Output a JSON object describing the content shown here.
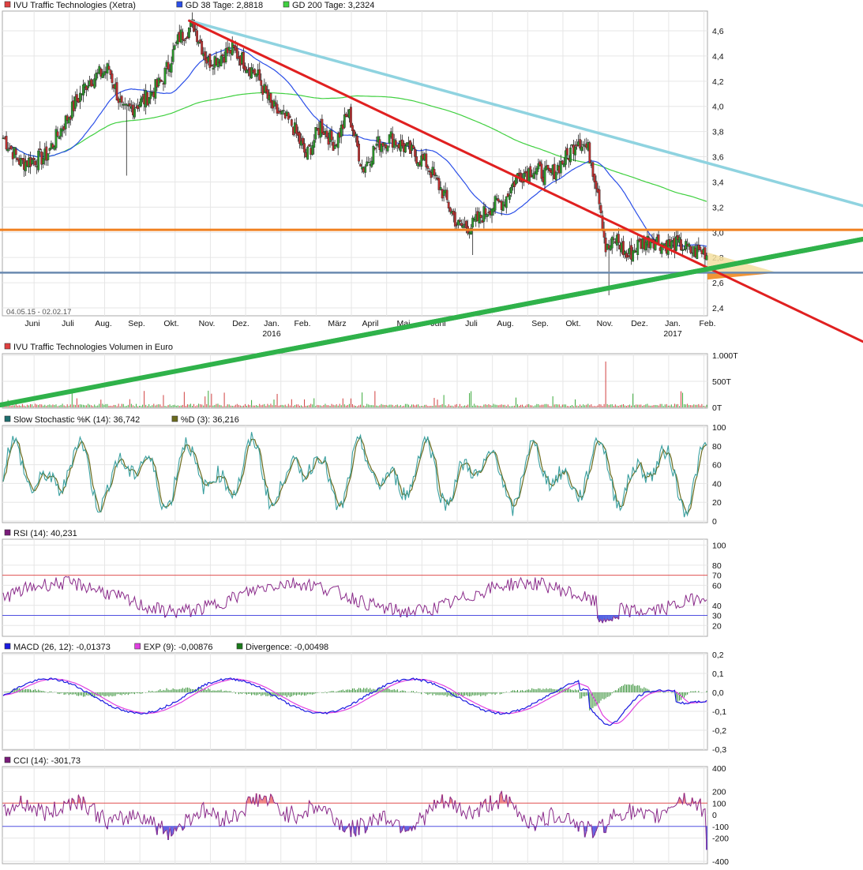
{
  "instrument": "IVU Traffic Technologies",
  "price_panel": {
    "legend": [
      {
        "label": "IVU Traffic Technologies (Xetra)",
        "color": "#e04040"
      },
      {
        "label": "GD 38 Tage: 2,8818",
        "color": "#2b4fe8"
      },
      {
        "label": "GD 200 Tage: 3,2324",
        "color": "#40d040"
      }
    ],
    "date_range": "04.05.15 - 02.02.17",
    "y_ticks": [
      "4,6",
      "4,4",
      "4,2",
      "4,0",
      "3,8",
      "3,6",
      "3,4",
      "3,2",
      "3,0",
      "2,8",
      "2,6",
      "2,4"
    ],
    "x_ticks": [
      "Juni",
      "Juli",
      "Aug.",
      "Sep.",
      "Okt.",
      "Nov.",
      "Dez.",
      "Jan.",
      "Feb.",
      "März",
      "April",
      "Mai",
      "Juni",
      "Juli",
      "Aug.",
      "Sep.",
      "Okt.",
      "Nov.",
      "Dez.",
      "Jan.",
      "Feb."
    ],
    "year_labels": [
      "2016",
      "2017"
    ]
  },
  "volume_panel": {
    "legend": [
      {
        "label": "IVU Traffic Technologies Volumen in Euro",
        "color": "#e04040"
      }
    ],
    "y_ticks": [
      "1.000T",
      "500T",
      "0T"
    ]
  },
  "stoch_panel": {
    "legend": [
      {
        "label": "Slow Stochastic %K (14): 36,742",
        "color": "#1d6e6e"
      },
      {
        "label": "%D (3): 36,216",
        "color": "#6b6b1d"
      }
    ],
    "y_ticks": [
      "100",
      "80",
      "60",
      "40",
      "20",
      "0"
    ]
  },
  "rsi_panel": {
    "legend": [
      {
        "label": "RSI (14): 40,231",
        "color": "#7a1a7a"
      }
    ],
    "y_ticks": [
      "100",
      "80",
      "60",
      "40",
      "20"
    ],
    "band_labels": [
      "70",
      "30"
    ]
  },
  "macd_panel": {
    "legend": [
      {
        "label": "MACD (26, 12): -0,01373",
        "color": "#1a1ae0"
      },
      {
        "label": "EXP (9): -0,00876",
        "color": "#e040e0"
      },
      {
        "label": "Divergence: -0,00498",
        "color": "#1a7a1a"
      }
    ],
    "y_ticks": [
      "0,2",
      "0,1",
      "0,0",
      "-0,1",
      "-0,2",
      "-0,3"
    ]
  },
  "cci_panel": {
    "legend": [
      {
        "label": "CCI (14): -301,73",
        "color": "#7a1a7a"
      }
    ],
    "y_ticks": [
      "400",
      "200",
      "0",
      "-200",
      "-400"
    ],
    "band_labels": [
      "100",
      "-100"
    ]
  },
  "chart_data": {
    "type": "line",
    "title": "IVU Traffic Technologies (Xetra)",
    "x_range": [
      "2015-05-04",
      "2017-02-02"
    ],
    "ylim": [
      2.4,
      4.7
    ],
    "price_anchors": [
      {
        "month": 0.0,
        "close": 3.75
      },
      {
        "month": 0.5,
        "close": 3.55
      },
      {
        "month": 1.2,
        "close": 3.6
      },
      {
        "month": 1.8,
        "close": 3.9
      },
      {
        "month": 2.4,
        "close": 4.2
      },
      {
        "month": 3.0,
        "close": 4.3
      },
      {
        "month": 3.4,
        "close": 3.95
      },
      {
        "month": 4.0,
        "close": 4.05
      },
      {
        "month": 4.5,
        "close": 4.2
      },
      {
        "month": 5.0,
        "close": 4.55
      },
      {
        "month": 5.4,
        "close": 4.65
      },
      {
        "month": 5.8,
        "close": 4.35
      },
      {
        "month": 6.5,
        "close": 4.45
      },
      {
        "month": 7.2,
        "close": 4.25
      },
      {
        "month": 7.6,
        "close": 4.0
      },
      {
        "month": 8.2,
        "close": 3.85
      },
      {
        "month": 8.6,
        "close": 3.6
      },
      {
        "month": 9.0,
        "close": 3.85
      },
      {
        "month": 9.4,
        "close": 3.7
      },
      {
        "month": 9.8,
        "close": 3.95
      },
      {
        "month": 10.2,
        "close": 3.5
      },
      {
        "month": 10.6,
        "close": 3.7
      },
      {
        "month": 11.0,
        "close": 3.75
      },
      {
        "month": 11.5,
        "close": 3.65
      },
      {
        "month": 12.0,
        "close": 3.55
      },
      {
        "month": 12.5,
        "close": 3.3
      },
      {
        "month": 12.9,
        "close": 3.05
      },
      {
        "month": 13.3,
        "close": 3.05
      },
      {
        "month": 13.8,
        "close": 3.2
      },
      {
        "month": 14.2,
        "close": 3.25
      },
      {
        "month": 14.6,
        "close": 3.45
      },
      {
        "month": 15.0,
        "close": 3.5
      },
      {
        "month": 15.5,
        "close": 3.45
      },
      {
        "month": 16.0,
        "close": 3.6
      },
      {
        "month": 16.3,
        "close": 3.75
      },
      {
        "month": 16.6,
        "close": 3.65
      },
      {
        "month": 16.9,
        "close": 3.3
      },
      {
        "month": 17.1,
        "close": 2.85
      },
      {
        "month": 17.4,
        "close": 2.95
      },
      {
        "month": 17.7,
        "close": 2.8
      },
      {
        "month": 18.0,
        "close": 2.9
      },
      {
        "month": 18.4,
        "close": 2.95
      },
      {
        "month": 18.8,
        "close": 2.9
      },
      {
        "month": 19.2,
        "close": 2.9
      },
      {
        "month": 19.5,
        "close": 2.85
      },
      {
        "month": 19.9,
        "close": 2.85
      },
      {
        "month": 20.0,
        "close": 2.8
      }
    ],
    "trendlines": [
      {
        "name": "resistance-red",
        "from": {
          "month": 5.3,
          "price": 4.68
        },
        "to": {
          "month": 20.0,
          "price": 2.72
        },
        "color": "#e02020"
      },
      {
        "name": "resistance-lightblue",
        "from": {
          "month": 5.3,
          "price": 4.68
        },
        "to": {
          "month": 20.0,
          "price": 3.55
        },
        "color": "#8fd3e0"
      },
      {
        "name": "support-green",
        "from": {
          "month": 0.0,
          "price": 1.7
        },
        "to": {
          "month": 20.0,
          "price": 2.65
        },
        "color": "#2fb24a"
      }
    ],
    "horizontal_lines": [
      {
        "price": 3.02,
        "color": "#f08020"
      },
      {
        "price": 2.68,
        "color": "#6a8ab0"
      }
    ],
    "gd38_last": 2.8818,
    "gd200_last": 3.2324,
    "stoch_k_last": 36.742,
    "stoch_d_last": 36.216,
    "rsi_last": 40.231,
    "macd_last": -0.01373,
    "macd_exp_last": -0.00876,
    "macd_divergence_last": -0.00498,
    "cci_last": -301.73
  }
}
